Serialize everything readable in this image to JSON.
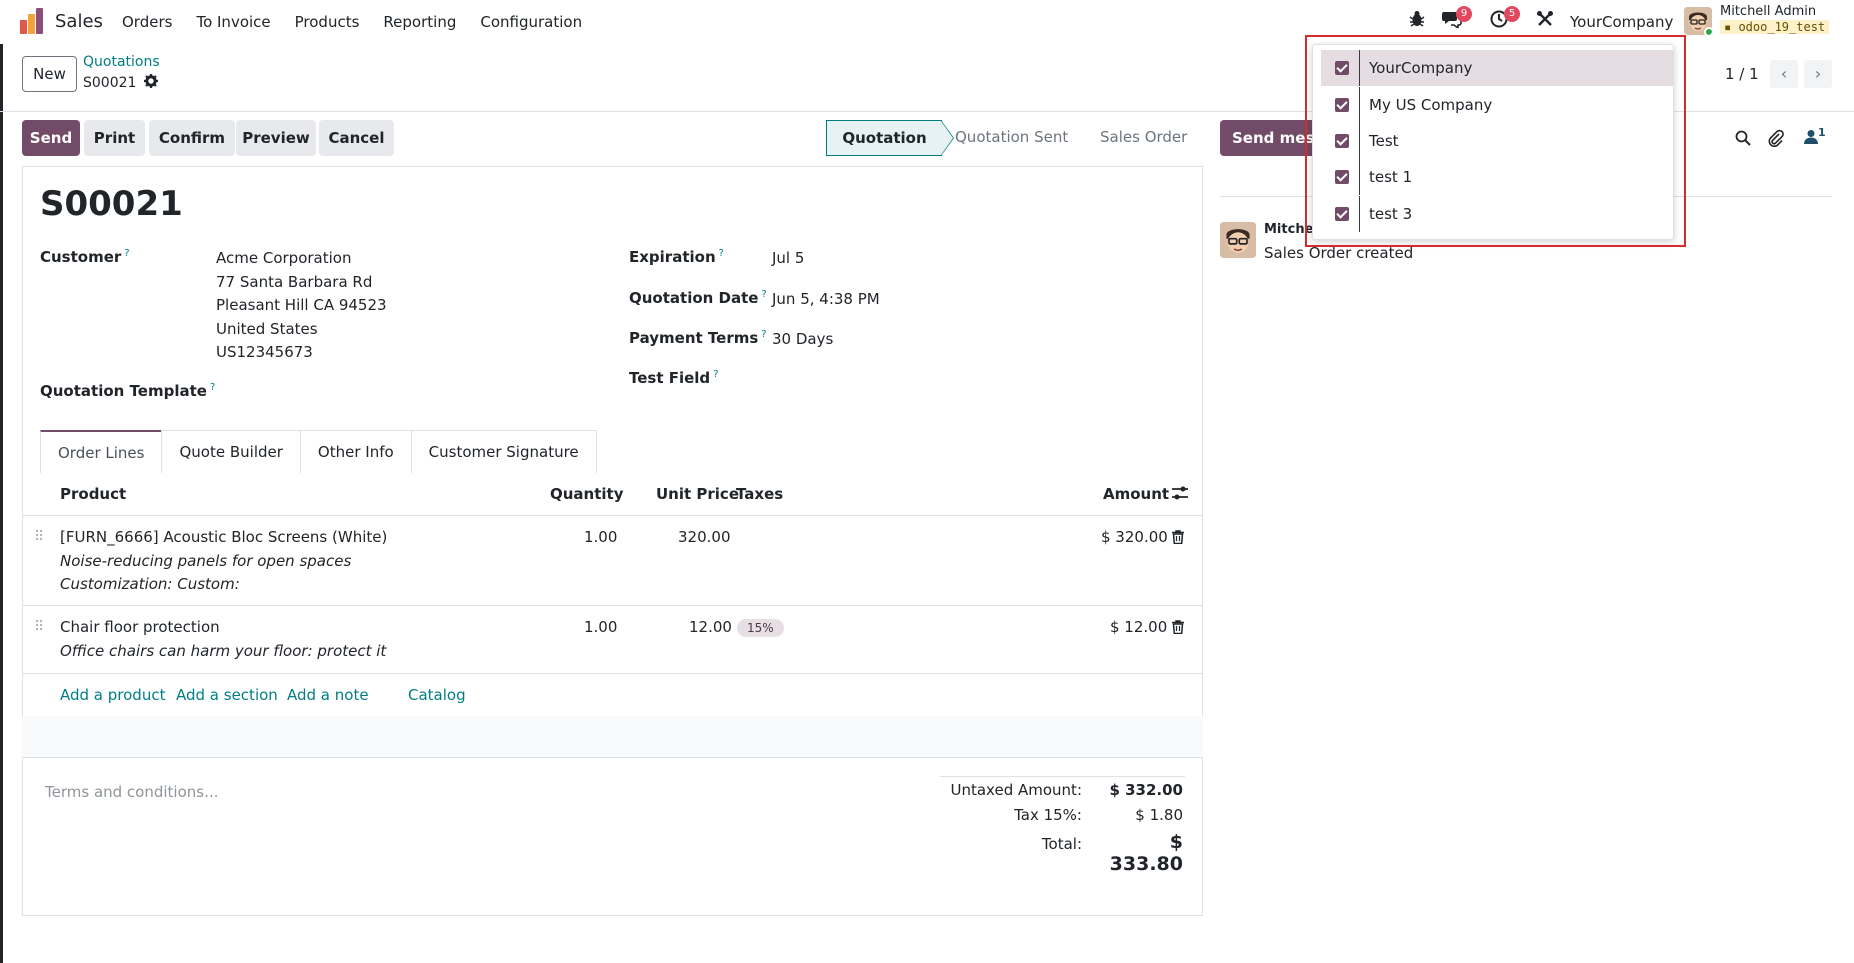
{
  "topbar": {
    "app_name": "Sales",
    "menu": [
      "Orders",
      "To Invoice",
      "Products",
      "Reporting",
      "Configuration"
    ],
    "messages_count": "9",
    "activities_count": "5",
    "company": "YourCompany",
    "user_name": "Mitchell Admin",
    "db_name": "odoo_19_test"
  },
  "control": {
    "new_label": "New",
    "breadcrumb": "Quotations",
    "record_name": "S00021",
    "pager": "1 / 1"
  },
  "actions": {
    "send": "Send",
    "print": "Print",
    "confirm": "Confirm",
    "preview": "Preview",
    "cancel": "Cancel"
  },
  "stages": [
    "Quotation",
    "Quotation Sent",
    "Sales Order"
  ],
  "form": {
    "title": "S00021",
    "customer_label": "Customer",
    "customer_lines": [
      "Acme Corporation",
      "77 Santa Barbara Rd",
      "Pleasant Hill CA 94523",
      "United States",
      "US12345673"
    ],
    "template_label": "Quotation Template",
    "expiration_label": "Expiration",
    "expiration": "Jul 5",
    "quotation_date_label": "Quotation Date",
    "quotation_date": "Jun 5, 4:38 PM",
    "payment_terms_label": "Payment Terms",
    "payment_terms": "30 Days",
    "test_field_label": "Test Field",
    "help_mark": "?"
  },
  "tabs": [
    "Order Lines",
    "Quote Builder",
    "Other Info",
    "Customer Signature"
  ],
  "table": {
    "headers": {
      "product": "Product",
      "quantity": "Quantity",
      "unit_price": "Unit Price",
      "taxes": "Taxes",
      "amount": "Amount"
    },
    "rows": [
      {
        "product": "[FURN_6666] Acoustic Bloc Screens (White)",
        "desc1": "Noise-reducing panels for open spaces",
        "desc2": "Customization: Custom:",
        "quantity": "1.00",
        "unit_price": "320.00",
        "tax": "",
        "amount": "$ 320.00"
      },
      {
        "product": "Chair floor protection",
        "desc1": "Office chairs can harm your floor: protect it",
        "desc2": "",
        "quantity": "1.00",
        "unit_price": "12.00",
        "tax": "15%",
        "amount": "$ 12.00"
      }
    ],
    "add_product": "Add a product",
    "add_section": "Add a section",
    "add_note": "Add a note",
    "catalog": "Catalog"
  },
  "footer": {
    "terms_placeholder": "Terms and conditions...",
    "untaxed_label": "Untaxed Amount:",
    "untaxed": "$ 332.00",
    "tax_label": "Tax 15%:",
    "tax": "$ 1.80",
    "total_label": "Total:",
    "total": "$ 333.80"
  },
  "chatter": {
    "send_message": "Send message",
    "followers_count": "1",
    "author": "Mitchell Admin",
    "body": "Sales Order created"
  },
  "company_dropdown": {
    "items": [
      {
        "label": "YourCompany",
        "checked": true
      },
      {
        "label": "My US Company",
        "checked": true
      },
      {
        "label": "Test",
        "checked": true
      },
      {
        "label": "test 1",
        "checked": true
      },
      {
        "label": "test 3",
        "checked": true
      }
    ]
  },
  "colors": {
    "brand": "#714b67",
    "link": "#017e84",
    "badge": "#e3475f"
  }
}
